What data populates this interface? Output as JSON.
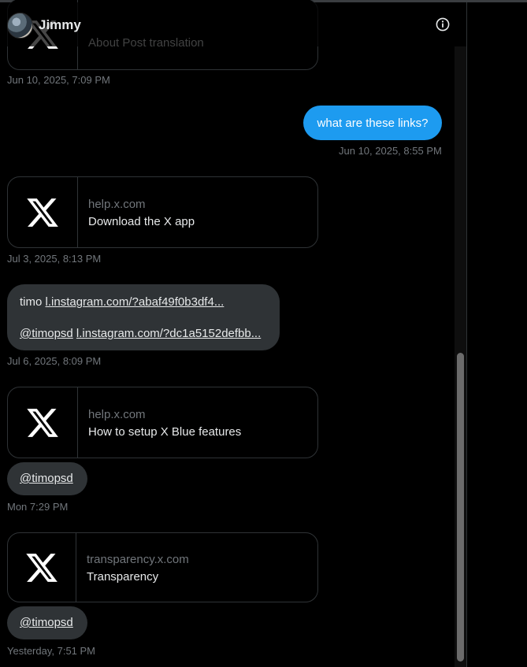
{
  "header": {
    "name": "Jimmy",
    "avatar_icon": "avatar",
    "info_icon": "info-icon"
  },
  "messages": {
    "m0": {
      "title": "About Post translation",
      "timestamp": "Jun 10, 2025, 7:09 PM"
    },
    "m1": {
      "text": "what are these links?",
      "timestamp": "Jun 10, 2025, 8:55 PM"
    },
    "m2": {
      "domain": "help.x.com",
      "title": "Download the X app",
      "timestamp": "Jul 3, 2025, 8:13 PM"
    },
    "m3": {
      "line1_prefix": "timo",
      "line1_link": "l.instagram.com/?abaf49f0b3df4...",
      "line2_mention": "@timopsd",
      "line2_link": "l.instagram.com/?dc1a5152defbb...",
      "timestamp": "Jul 6, 2025, 8:09 PM"
    },
    "m4": {
      "domain": "help.x.com",
      "title": "How to setup X Blue features"
    },
    "m5": {
      "mention": "@timopsd",
      "timestamp": "Mon 7:29 PM"
    },
    "m6": {
      "domain": "transparency.x.com",
      "title": "Transparency"
    },
    "m7": {
      "mention": "@timopsd",
      "timestamp": "Yesterday, 7:51 PM"
    }
  },
  "colors": {
    "accent": "#1d9bf0",
    "bubble": "#2f3336",
    "muted": "#71767b",
    "background": "#000000"
  }
}
